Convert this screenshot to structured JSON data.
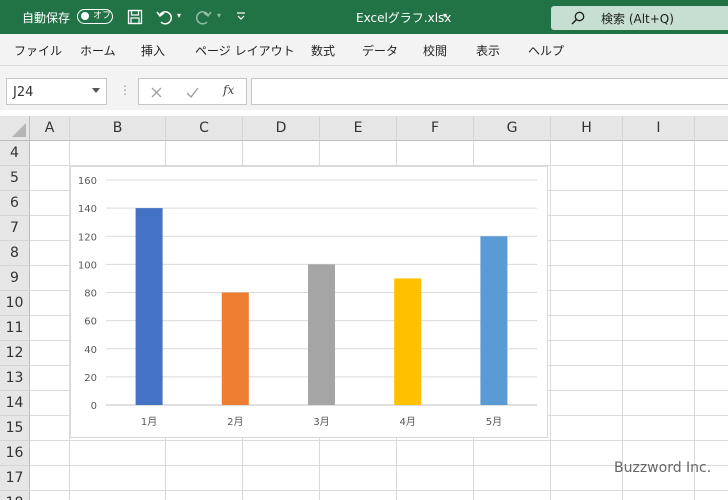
{
  "titlebar": {
    "autosave_label": "自動保存",
    "autosave_state": "オフ",
    "filename": "Excelグラフ.xlsx",
    "search_label": "検索 (Alt+Q)",
    "accent": "#217346"
  },
  "ribbon": {
    "tabs": [
      "ファイル",
      "ホーム",
      "挿入",
      "ページ レイアウト",
      "数式",
      "データ",
      "校閲",
      "表示",
      "ヘルプ"
    ]
  },
  "formula_bar": {
    "name_box": "J24",
    "fx_label": "fx",
    "value": ""
  },
  "sheet": {
    "columns": [
      "A",
      "B",
      "C",
      "D",
      "E",
      "F",
      "G",
      "H",
      "I"
    ],
    "rows": [
      "4",
      "5",
      "6",
      "7",
      "8",
      "9",
      "10",
      "11",
      "12",
      "13",
      "14",
      "15",
      "16",
      "17",
      "18"
    ]
  },
  "chart_data": {
    "type": "bar",
    "categories": [
      "1月",
      "2月",
      "3月",
      "4月",
      "5月"
    ],
    "values": [
      140,
      80,
      100,
      90,
      120
    ],
    "colors": [
      "#4472c4",
      "#ed7d31",
      "#a5a5a5",
      "#ffc000",
      "#5b9bd5"
    ],
    "yticks": [
      "0",
      "20",
      "40",
      "60",
      "80",
      "100",
      "120",
      "140",
      "160"
    ],
    "ylim": [
      0,
      160
    ],
    "grid": true,
    "title": "",
    "xlabel": "",
    "ylabel": ""
  },
  "watermark": "Buzzword Inc."
}
